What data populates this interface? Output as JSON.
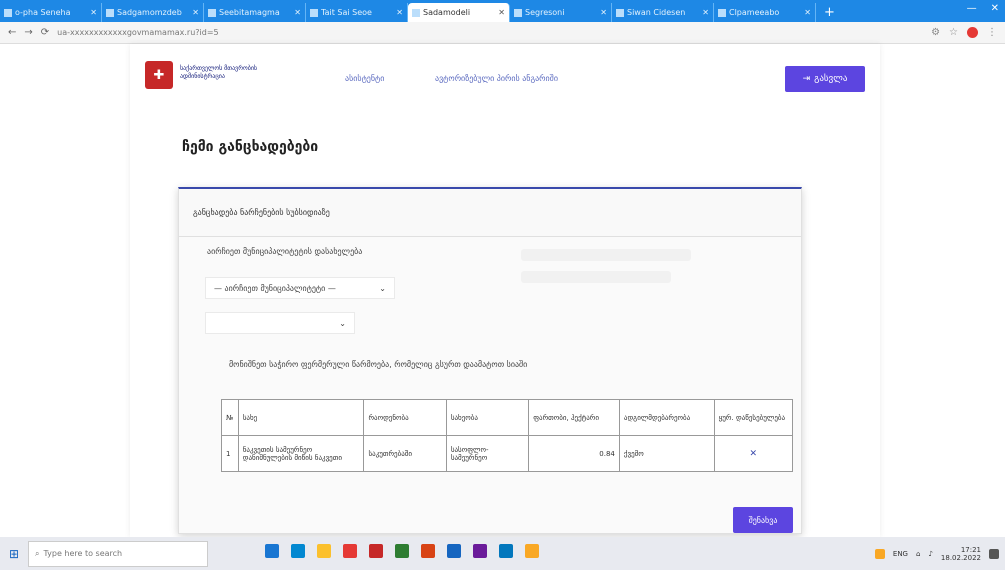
{
  "browser": {
    "tabs": [
      {
        "label": "o-pha Seneha",
        "active": false
      },
      {
        "label": "Sadgamomzdeb",
        "active": false
      },
      {
        "label": "Seebitamagma",
        "active": false
      },
      {
        "label": "Tait Sai Seoe",
        "active": false
      },
      {
        "label": "Sadamodeli",
        "active": true
      },
      {
        "label": "Segresoni",
        "active": false
      },
      {
        "label": "Siwan Cidesen",
        "active": false
      },
      {
        "label": "Clpameeabo",
        "active": false
      }
    ],
    "new_tab_label": "+",
    "url": "ua-xxxxxxxxxxxxgovmamamax.ru?id=5",
    "nav": {
      "back": "←",
      "forward": "→",
      "reload": "⟳"
    }
  },
  "site": {
    "logo_text": "საქართველოს მთავრობის ადმინისტრაცია",
    "nav_links": [
      "ასისტენტი",
      "ავტორიზებული პირის ანგარიში"
    ],
    "logout_label": "გასვლა",
    "page_title": "ჩემი განცხადებები"
  },
  "card": {
    "header": "განცხადება ნარჩენების სუბსიდიაზე",
    "field_label": "აირჩიეთ მუნიციპალიტეტის დასახელება",
    "select1_value": "— აირჩიეთ მუნიციპალიტეტი —",
    "select2_value": "",
    "instruction": "მონიშნეთ საჭირო ფერმერული წარმოება, რომელიც გსურთ დაამატოთ სიაში"
  },
  "table": {
    "headers": [
      "№",
      "სახე",
      "რაოდენობა",
      "სახეობა",
      "ფართობი, ჰექტარი",
      "ადგილმდებარეობა",
      "ყურ. დაწესებულება"
    ],
    "rows": [
      {
        "num": "1",
        "name": "ნაკვეთის სამეურნეო დანიშნულების მიწის ნაკვეთი",
        "qty": "საკუთრებაში",
        "type": "სასოფლო-სამეურნეო",
        "area": "0.84",
        "location": "ქვემო",
        "mark": "✕"
      }
    ]
  },
  "save_label": "შენახვა",
  "taskbar": {
    "search_placeholder": "Type here to search",
    "tray_label": "ENG",
    "time": "17:21",
    "date": "18.02.2022"
  }
}
